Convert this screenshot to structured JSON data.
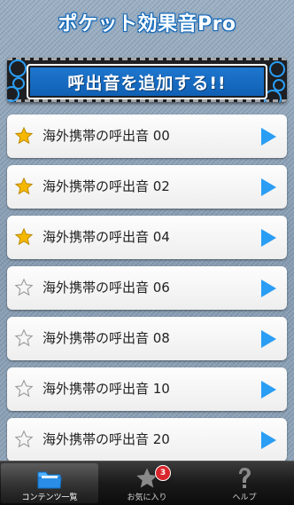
{
  "header": {
    "title": "ポケット効果音Pro"
  },
  "banner": {
    "label": "呼出音を追加する!!"
  },
  "list": {
    "items": [
      {
        "label": "海外携帯の呼出音 00",
        "favorite": true
      },
      {
        "label": "海外携帯の呼出音 02",
        "favorite": true
      },
      {
        "label": "海外携帯の呼出音 04",
        "favorite": true
      },
      {
        "label": "海外携帯の呼出音 06",
        "favorite": false
      },
      {
        "label": "海外携帯の呼出音 08",
        "favorite": false
      },
      {
        "label": "海外携帯の呼出音 10",
        "favorite": false
      },
      {
        "label": "海外携帯の呼出音 20",
        "favorite": false
      }
    ]
  },
  "tabbar": {
    "tabs": [
      {
        "label": "コンテンツ一覧",
        "icon": "folder-icon",
        "active": true
      },
      {
        "label": "お気に入り",
        "icon": "star-icon",
        "badge": "3",
        "active": false
      },
      {
        "label": "ヘルプ",
        "icon": "question-icon",
        "active": false
      }
    ]
  },
  "colors": {
    "accent": "#1f78cf",
    "play": "#2a9df4",
    "star_on": "#f5b800",
    "badge": "#d9262c"
  }
}
